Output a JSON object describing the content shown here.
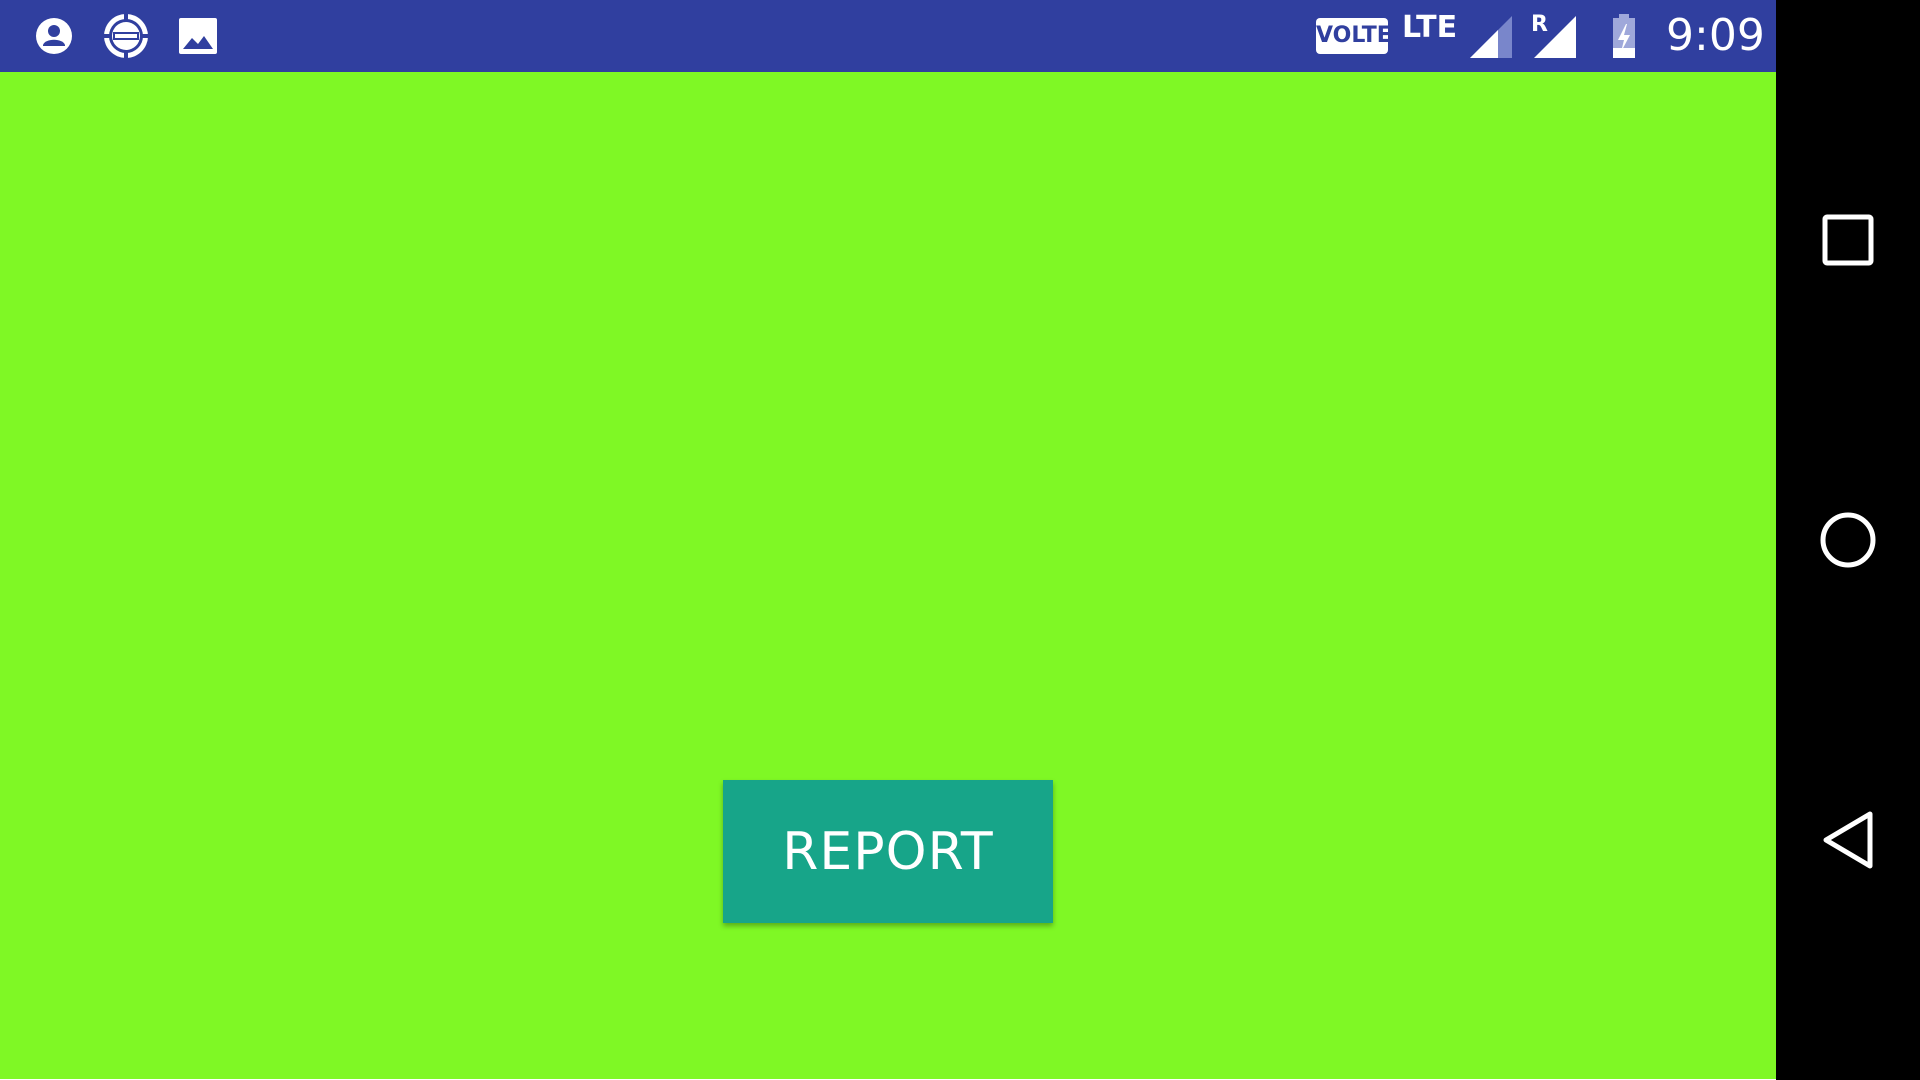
{
  "status_bar": {
    "time": "9:09",
    "volte_label": "VOLTE",
    "network_label": "LTE",
    "roaming_label": "R",
    "background_color": "#303F9F",
    "icons": [
      "account-circle-icon",
      "wsop-app-icon",
      "image-icon",
      "signal-icon",
      "roaming-signal-icon",
      "battery-charging-icon"
    ]
  },
  "app": {
    "background_color": "#7FF825",
    "report_button_label": "REPORT",
    "report_button_color": "#17A589"
  },
  "nav_bar": {
    "buttons": [
      "recents-square-icon",
      "home-circle-icon",
      "back-triangle-icon"
    ]
  }
}
